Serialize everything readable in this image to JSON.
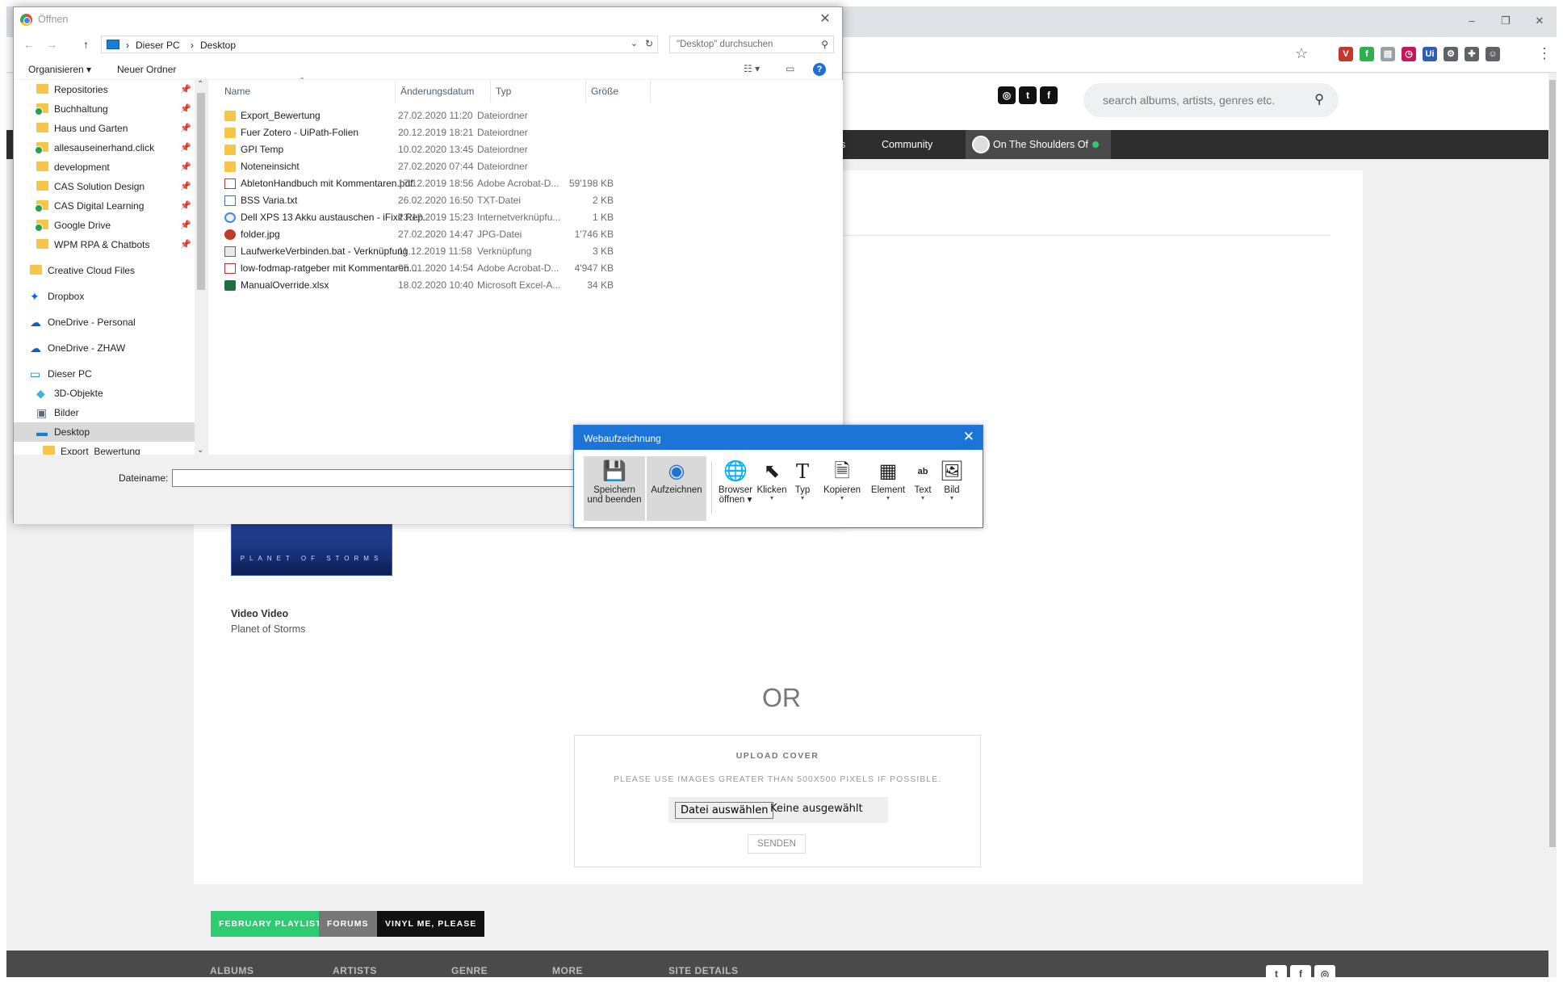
{
  "colors": {
    "accent_blue": "#1d74d8",
    "nav_dark": "#2e2e2e",
    "cta_green": "#2ecc71",
    "cta_grey": "#777777",
    "cta_black": "#111111",
    "footer_grey": "#4a4a4a"
  },
  "browser": {
    "win_controls": [
      "–",
      "❐",
      "✕"
    ],
    "star_icon": "☆",
    "extensions": [
      {
        "name": "vivaldi-icon",
        "glyph": "V",
        "color": "#c0392b"
      },
      {
        "name": "feedly-icon",
        "glyph": "f",
        "color": "#2bb24c"
      },
      {
        "name": "document-icon",
        "glyph": "▤",
        "color": "#9aa0a6"
      },
      {
        "name": "timer-icon",
        "glyph": "◷",
        "color": "#c2185b"
      },
      {
        "name": "uipath-icon",
        "glyph": "Ui",
        "color": "#2e5fb5"
      },
      {
        "name": "gear-icon",
        "glyph": "⚙",
        "color": "#5f6368"
      },
      {
        "name": "puzzle-icon",
        "glyph": "✚",
        "color": "#5f6368"
      },
      {
        "name": "profile-icon",
        "glyph": "☺",
        "color": "#5f6368"
      }
    ],
    "menu_icon": "⋮"
  },
  "site": {
    "social_top": [
      "◎",
      "t",
      "f"
    ],
    "search_placeholder": "search albums, artists, genres etc.",
    "search_icon": "⚲",
    "nav": {
      "cut_label": "ws",
      "community": "Community",
      "shoulders": "On The Shoulders Of"
    },
    "album": {
      "cover_text": "PLANET OF STORMS",
      "title": "Video Video",
      "subtitle": "Planet of Storms"
    },
    "or": "OR",
    "upload": {
      "title": "UPLOAD COVER",
      "hint": "PLEASE USE IMAGES GREATER THAN 500X500 PIXELS IF POSSIBLE.",
      "file_button": "Datei auswählen",
      "file_none": "Keine ausgewählt",
      "send": "SENDEN"
    },
    "cta": [
      {
        "label": "FEBRUARY PLAYLIST",
        "color": "#2ecc71"
      },
      {
        "label": "FORUMS",
        "color": "#777777"
      },
      {
        "label": "VINYL ME, PLEASE",
        "color": "#111111"
      }
    ],
    "footer": [
      "ALBUMS",
      "ARTISTS",
      "GENRE",
      "MORE",
      "SITE DETAILS"
    ],
    "social_foot": [
      "t",
      "f",
      "◎"
    ]
  },
  "dialog": {
    "title": "Öffnen",
    "close": "✕",
    "nav_back": "←",
    "nav_forward": "→",
    "nav_up": "↑",
    "breadcrumb": [
      "Dieser PC",
      "Desktop"
    ],
    "crumb_sep": "›",
    "search_placeholder": "\"Desktop\" durchsuchen",
    "search_icon": "⚲",
    "cmd": {
      "organize": "Organisieren ▾",
      "new_folder": "Neuer Ordner",
      "view_icon": "☷ ▾",
      "pane_icon": "▭",
      "help": "?"
    },
    "nav_items": [
      {
        "label": "Repositories",
        "kind": "folder",
        "pin": true
      },
      {
        "label": "Buchhaltung",
        "kind": "sync",
        "pin": true
      },
      {
        "label": "Haus und Garten",
        "kind": "folder",
        "pin": true
      },
      {
        "label": "allesauseinerhand.click",
        "kind": "sync",
        "pin": true
      },
      {
        "label": "development",
        "kind": "folder",
        "pin": true
      },
      {
        "label": "CAS Solution Design",
        "kind": "folder",
        "pin": true
      },
      {
        "label": "CAS Digital Learning",
        "kind": "sync",
        "pin": true
      },
      {
        "label": "Google Drive",
        "kind": "sync",
        "pin": true
      },
      {
        "label": "WPM RPA & Chatbots",
        "kind": "folder",
        "pin": true
      },
      {
        "label": "Creative Cloud Files",
        "kind": "folder",
        "pin": false
      },
      {
        "label": "Dropbox",
        "kind": "dropbox",
        "pin": false
      },
      {
        "label": "OneDrive - Personal",
        "kind": "cloud",
        "pin": false
      },
      {
        "label": "OneDrive - ZHAW",
        "kind": "cloud",
        "pin": false
      },
      {
        "label": "Dieser PC",
        "kind": "pc",
        "pin": false
      },
      {
        "label": "3D-Objekte",
        "kind": "cube",
        "pin": false
      },
      {
        "label": "Bilder",
        "kind": "pics",
        "pin": false
      },
      {
        "label": "Desktop",
        "kind": "desktop",
        "pin": false
      },
      {
        "label": "Export_Bewertung",
        "kind": "folder",
        "pin": false
      }
    ],
    "columns": [
      "Name",
      "Änderungsdatum",
      "Typ",
      "Größe"
    ],
    "files": [
      {
        "name": "Export_Bewertung",
        "date": "27.02.2020 11:20",
        "type": "Dateiordner",
        "size": "",
        "icon": "folder"
      },
      {
        "name": "Fuer Zotero - UiPath-Folien",
        "date": "20.12.2019 18:21",
        "type": "Dateiordner",
        "size": "",
        "icon": "folder"
      },
      {
        "name": "GPI Temp",
        "date": "10.02.2020 13:45",
        "type": "Dateiordner",
        "size": "",
        "icon": "folder"
      },
      {
        "name": "Noteneinsicht",
        "date": "27.02.2020 07:44",
        "type": "Dateiordner",
        "size": "",
        "icon": "folder"
      },
      {
        "name": "AbletonHandbuch mit Kommentaren.pdf",
        "date": "17.12.2019 18:56",
        "type": "Adobe Acrobat-D...",
        "size": "59'198 KB",
        "icon": "pdf"
      },
      {
        "name": "BSS Varia.txt",
        "date": "26.02.2020 16:50",
        "type": "TXT-Datei",
        "size": "2 KB",
        "icon": "txt"
      },
      {
        "name": "Dell XPS 13 Akku austauschen - iFixit Rep...",
        "date": "23.12.2019 15:23",
        "type": "Internetverknüpfu...",
        "size": "1 KB",
        "icon": "url"
      },
      {
        "name": "folder.jpg",
        "date": "27.02.2020 14:47",
        "type": "JPG-Datei",
        "size": "1'746 KB",
        "icon": "jpg"
      },
      {
        "name": "LaufwerkeVerbinden.bat - Verknüpfung",
        "date": "11.12.2019 11:58",
        "type": "Verknüpfung",
        "size": "3 KB",
        "icon": "bat"
      },
      {
        "name": "low-fodmap-ratgeber mit Kommentaren...",
        "date": "05.01.2020 14:54",
        "type": "Adobe Acrobat-D...",
        "size": "4'947 KB",
        "icon": "pdf"
      },
      {
        "name": "ManualOverride.xlsx",
        "date": "18.02.2020 10:40",
        "type": "Microsoft Excel-A...",
        "size": "34 KB",
        "icon": "xlsx"
      }
    ],
    "filename_label": "Dateiname:",
    "filename_value": ""
  },
  "recorder": {
    "title": "Webaufzeichnung",
    "close": "✕",
    "tools": [
      {
        "name": "save-exit",
        "glyph": "💾",
        "line1": "Speichern",
        "line2": "und beenden",
        "caret": false,
        "active": true
      },
      {
        "name": "record",
        "glyph": "◉",
        "line1": "Aufzeichnen",
        "line2": "",
        "caret": false,
        "active": true
      },
      {
        "name": "open-browser",
        "glyph": "🌐",
        "line1": "Browser",
        "line2": "öffnen ▾",
        "caret": false,
        "active": false
      },
      {
        "name": "click",
        "glyph": "⬉",
        "line1": "Klicken",
        "line2": "",
        "caret": true,
        "active": false
      },
      {
        "name": "type",
        "glyph": "T",
        "line1": "Typ",
        "line2": "",
        "caret": true,
        "active": false
      },
      {
        "name": "copy",
        "glyph": "🗎",
        "line1": "Kopieren",
        "line2": "",
        "caret": true,
        "active": false
      },
      {
        "name": "element",
        "glyph": "▦",
        "line1": "Element",
        "line2": "",
        "caret": true,
        "active": false
      },
      {
        "name": "text",
        "glyph": "ab",
        "line1": "Text",
        "line2": "",
        "caret": true,
        "active": false
      },
      {
        "name": "image",
        "glyph": "🖼",
        "line1": "Bild",
        "line2": "",
        "caret": true,
        "active": false
      }
    ]
  }
}
